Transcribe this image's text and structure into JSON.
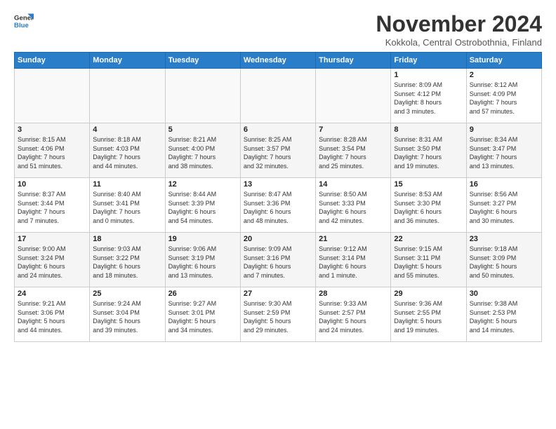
{
  "logo": {
    "line1": "General",
    "line2": "Blue"
  },
  "title": "November 2024",
  "subtitle": "Kokkola, Central Ostrobothnia, Finland",
  "days_of_week": [
    "Sunday",
    "Monday",
    "Tuesday",
    "Wednesday",
    "Thursday",
    "Friday",
    "Saturday"
  ],
  "weeks": [
    [
      {
        "day": "",
        "info": ""
      },
      {
        "day": "",
        "info": ""
      },
      {
        "day": "",
        "info": ""
      },
      {
        "day": "",
        "info": ""
      },
      {
        "day": "",
        "info": ""
      },
      {
        "day": "1",
        "info": "Sunrise: 8:09 AM\nSunset: 4:12 PM\nDaylight: 8 hours\nand 3 minutes."
      },
      {
        "day": "2",
        "info": "Sunrise: 8:12 AM\nSunset: 4:09 PM\nDaylight: 7 hours\nand 57 minutes."
      }
    ],
    [
      {
        "day": "3",
        "info": "Sunrise: 8:15 AM\nSunset: 4:06 PM\nDaylight: 7 hours\nand 51 minutes."
      },
      {
        "day": "4",
        "info": "Sunrise: 8:18 AM\nSunset: 4:03 PM\nDaylight: 7 hours\nand 44 minutes."
      },
      {
        "day": "5",
        "info": "Sunrise: 8:21 AM\nSunset: 4:00 PM\nDaylight: 7 hours\nand 38 minutes."
      },
      {
        "day": "6",
        "info": "Sunrise: 8:25 AM\nSunset: 3:57 PM\nDaylight: 7 hours\nand 32 minutes."
      },
      {
        "day": "7",
        "info": "Sunrise: 8:28 AM\nSunset: 3:54 PM\nDaylight: 7 hours\nand 25 minutes."
      },
      {
        "day": "8",
        "info": "Sunrise: 8:31 AM\nSunset: 3:50 PM\nDaylight: 7 hours\nand 19 minutes."
      },
      {
        "day": "9",
        "info": "Sunrise: 8:34 AM\nSunset: 3:47 PM\nDaylight: 7 hours\nand 13 minutes."
      }
    ],
    [
      {
        "day": "10",
        "info": "Sunrise: 8:37 AM\nSunset: 3:44 PM\nDaylight: 7 hours\nand 7 minutes."
      },
      {
        "day": "11",
        "info": "Sunrise: 8:40 AM\nSunset: 3:41 PM\nDaylight: 7 hours\nand 0 minutes."
      },
      {
        "day": "12",
        "info": "Sunrise: 8:44 AM\nSunset: 3:39 PM\nDaylight: 6 hours\nand 54 minutes."
      },
      {
        "day": "13",
        "info": "Sunrise: 8:47 AM\nSunset: 3:36 PM\nDaylight: 6 hours\nand 48 minutes."
      },
      {
        "day": "14",
        "info": "Sunrise: 8:50 AM\nSunset: 3:33 PM\nDaylight: 6 hours\nand 42 minutes."
      },
      {
        "day": "15",
        "info": "Sunrise: 8:53 AM\nSunset: 3:30 PM\nDaylight: 6 hours\nand 36 minutes."
      },
      {
        "day": "16",
        "info": "Sunrise: 8:56 AM\nSunset: 3:27 PM\nDaylight: 6 hours\nand 30 minutes."
      }
    ],
    [
      {
        "day": "17",
        "info": "Sunrise: 9:00 AM\nSunset: 3:24 PM\nDaylight: 6 hours\nand 24 minutes."
      },
      {
        "day": "18",
        "info": "Sunrise: 9:03 AM\nSunset: 3:22 PM\nDaylight: 6 hours\nand 18 minutes."
      },
      {
        "day": "19",
        "info": "Sunrise: 9:06 AM\nSunset: 3:19 PM\nDaylight: 6 hours\nand 13 minutes."
      },
      {
        "day": "20",
        "info": "Sunrise: 9:09 AM\nSunset: 3:16 PM\nDaylight: 6 hours\nand 7 minutes."
      },
      {
        "day": "21",
        "info": "Sunrise: 9:12 AM\nSunset: 3:14 PM\nDaylight: 6 hours\nand 1 minute."
      },
      {
        "day": "22",
        "info": "Sunrise: 9:15 AM\nSunset: 3:11 PM\nDaylight: 5 hours\nand 55 minutes."
      },
      {
        "day": "23",
        "info": "Sunrise: 9:18 AM\nSunset: 3:09 PM\nDaylight: 5 hours\nand 50 minutes."
      }
    ],
    [
      {
        "day": "24",
        "info": "Sunrise: 9:21 AM\nSunset: 3:06 PM\nDaylight: 5 hours\nand 44 minutes."
      },
      {
        "day": "25",
        "info": "Sunrise: 9:24 AM\nSunset: 3:04 PM\nDaylight: 5 hours\nand 39 minutes."
      },
      {
        "day": "26",
        "info": "Sunrise: 9:27 AM\nSunset: 3:01 PM\nDaylight: 5 hours\nand 34 minutes."
      },
      {
        "day": "27",
        "info": "Sunrise: 9:30 AM\nSunset: 2:59 PM\nDaylight: 5 hours\nand 29 minutes."
      },
      {
        "day": "28",
        "info": "Sunrise: 9:33 AM\nSunset: 2:57 PM\nDaylight: 5 hours\nand 24 minutes."
      },
      {
        "day": "29",
        "info": "Sunrise: 9:36 AM\nSunset: 2:55 PM\nDaylight: 5 hours\nand 19 minutes."
      },
      {
        "day": "30",
        "info": "Sunrise: 9:38 AM\nSunset: 2:53 PM\nDaylight: 5 hours\nand 14 minutes."
      }
    ]
  ]
}
